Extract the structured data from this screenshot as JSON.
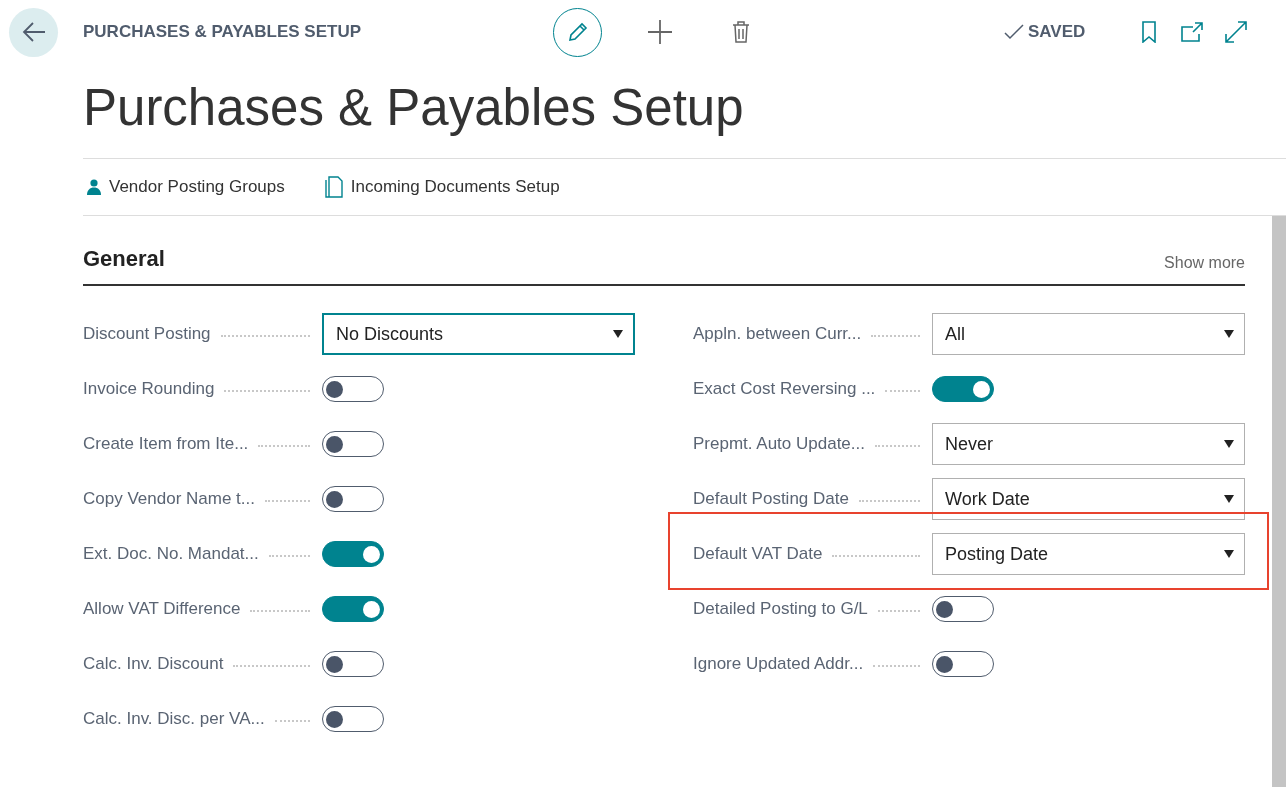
{
  "header": {
    "breadcrumb": "PURCHASES & PAYABLES SETUP",
    "status": "SAVED"
  },
  "title": "Purchases & Payables Setup",
  "actions": [
    {
      "label": "Vendor Posting Groups",
      "kind": "person"
    },
    {
      "label": "Incoming Documents Setup",
      "kind": "document"
    }
  ],
  "section": {
    "title": "General",
    "show_more": "Show more"
  },
  "left_fields": [
    {
      "label": "Discount Posting",
      "kind": "dropdown",
      "value": "No Discounts",
      "focused": true,
      "highlighted": false
    },
    {
      "label": "Invoice Rounding",
      "kind": "toggle",
      "on": false,
      "highlighted": false
    },
    {
      "label": "Create Item from Ite...",
      "kind": "toggle",
      "on": false,
      "highlighted": false
    },
    {
      "label": "Copy Vendor Name t...",
      "kind": "toggle",
      "on": false,
      "highlighted": false
    },
    {
      "label": "Ext. Doc. No. Mandat...",
      "kind": "toggle",
      "on": true,
      "highlighted": false
    },
    {
      "label": "Allow VAT Difference",
      "kind": "toggle",
      "on": true,
      "highlighted": false
    },
    {
      "label": "Calc. Inv. Discount",
      "kind": "toggle",
      "on": false,
      "highlighted": false
    },
    {
      "label": "Calc. Inv. Disc. per VA...",
      "kind": "toggle",
      "on": false,
      "highlighted": false
    }
  ],
  "right_fields": [
    {
      "label": "Appln. between Curr...",
      "kind": "dropdown",
      "value": "All",
      "focused": false,
      "highlighted": false
    },
    {
      "label": "Exact Cost Reversing ...",
      "kind": "toggle",
      "on": true,
      "highlighted": false
    },
    {
      "label": "Prepmt. Auto Update...",
      "kind": "dropdown",
      "value": "Never",
      "focused": false,
      "highlighted": false
    },
    {
      "label": "Default Posting Date",
      "kind": "dropdown",
      "value": "Work Date",
      "focused": false,
      "highlighted": false
    },
    {
      "label": "Default VAT Date",
      "kind": "dropdown",
      "value": "Posting Date",
      "focused": false,
      "highlighted": true
    },
    {
      "label": "Detailed Posting to G/L",
      "kind": "toggle",
      "on": false,
      "highlighted": false
    },
    {
      "label": "Ignore Updated Addr...",
      "kind": "toggle",
      "on": false,
      "highlighted": false
    }
  ]
}
